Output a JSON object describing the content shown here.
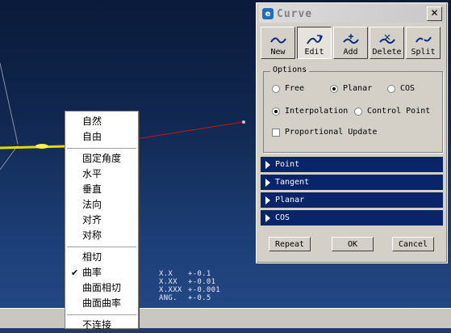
{
  "dialog": {
    "title": "Curve",
    "close_label": "✕",
    "toolbar": [
      {
        "label": "New",
        "icon": "curve-new-icon"
      },
      {
        "label": "Edit",
        "icon": "curve-edit-icon",
        "active": true
      },
      {
        "label": "Add",
        "icon": "curve-add-icon"
      },
      {
        "label": "Delete",
        "icon": "curve-delete-icon"
      },
      {
        "label": "Split",
        "icon": "curve-split-icon"
      }
    ],
    "options": {
      "legend": "Options",
      "type_free": "Free",
      "type_planar": "Planar",
      "type_cos": "COS",
      "selected_type": "Planar",
      "interp": "Interpolation",
      "control_point": "Control Point",
      "selected_mode": "Interpolation",
      "proportional": "Proportional Update",
      "proportional_checked": false
    },
    "sections": [
      "Point",
      "Tangent",
      "Planar",
      "COS"
    ],
    "buttons": {
      "repeat": "Repeat",
      "ok": "OK",
      "cancel": "Cancel"
    }
  },
  "context_menu": {
    "group1": [
      "自然",
      "自由"
    ],
    "group2": [
      "固定角度",
      "水平",
      "垂直",
      "法向",
      "对齐",
      "对称"
    ],
    "group3": [
      "相切",
      "曲率",
      "曲面相切",
      "曲面曲率"
    ],
    "group3_checked": "曲率",
    "group4": [
      "不连接"
    ]
  },
  "status": [
    {
      "label": "X.X",
      "value": "+-0.1"
    },
    {
      "label": "X.XX",
      "value": "+-0.01"
    },
    {
      "label": "X.XXX",
      "value": "+-0.001"
    },
    {
      "label": "ANG.",
      "value": "+-0.5"
    }
  ],
  "colors": {
    "section_bar": "#0a246a",
    "curve_line": "#d01010",
    "highlight": "#ffd400"
  }
}
